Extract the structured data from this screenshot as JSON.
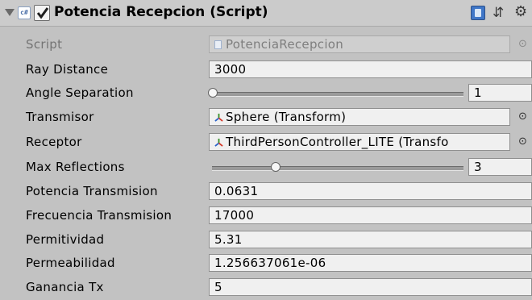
{
  "component": {
    "title": "Potencia Recepcion (Script)",
    "enabled": true,
    "script_icon_text": "c#"
  },
  "fields": {
    "script": {
      "label": "Script",
      "value": "PotenciaRecepcion"
    },
    "ray_distance": {
      "label": "Ray Distance",
      "value": "3000"
    },
    "angle_separation": {
      "label": "Angle Separation",
      "value": "1",
      "slider_fraction": 0.0
    },
    "transmisor": {
      "label": "Transmisor",
      "value": "Sphere (Transform)"
    },
    "receptor": {
      "label": "Receptor",
      "value": "ThirdPersonController_LITE (Transfo"
    },
    "max_reflections": {
      "label": "Max Reflections",
      "value": "3",
      "slider_fraction": 0.25
    },
    "potencia_transmision": {
      "label": "Potencia Transmision",
      "value": "0.0631"
    },
    "frecuencia_transmision": {
      "label": "Frecuencia Transmision",
      "value": "17000"
    },
    "permitividad": {
      "label": "Permitividad",
      "value": "5.31"
    },
    "permeabilidad": {
      "label": "Permeabilidad",
      "value": "1.256637061e-06"
    },
    "ganancia_tx": {
      "label": "Ganancia Tx",
      "value": "5"
    }
  },
  "icons": {
    "foldout": "triangle-down-icon",
    "script": "csharp-script-icon",
    "help": "help-book-icon",
    "preset": "preset-icon",
    "settings": "gear-icon",
    "object_picker": "object-picker-icon",
    "transform": "transform-axes-icon"
  },
  "colors": {
    "background": "#c2c2c2",
    "field": "#f0f0f0",
    "disabled_text": "#747474"
  }
}
